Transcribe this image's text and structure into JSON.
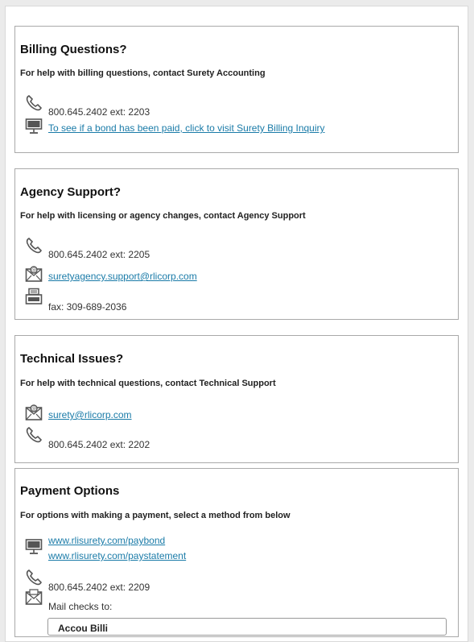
{
  "billing": {
    "title": "Billing Questions?",
    "desc": "For help with billing questions, contact Surety Accounting",
    "phone": "800.645.2402 ext: 2203",
    "link": "To see if a bond has been paid, click to visit Surety Billing Inquiry"
  },
  "agency": {
    "title": "Agency Support?",
    "desc": "For help with licensing or agency changes, contact Agency Support",
    "phone": "800.645.2402 ext: 2205",
    "email": "suretyagency.support@rlicorp.com",
    "fax": "fax: 309-689-2036"
  },
  "technical": {
    "title": "Technical Issues?",
    "desc": "For help with technical questions, contact Technical Support",
    "email": "surety@rlicorp.com",
    "phone": "800.645.2402 ext: 2202"
  },
  "payment": {
    "title": "Payment Options",
    "desc": "For options with making a payment, select a method from below",
    "link1": "www.rlisurety.com/paybond",
    "link2": "www.rlisurety.com/paystatement",
    "phone": "800.645.2402 ext: 2209",
    "mail_label": "Mail checks to:",
    "mail_address_first_line": "Accou  Billi"
  }
}
